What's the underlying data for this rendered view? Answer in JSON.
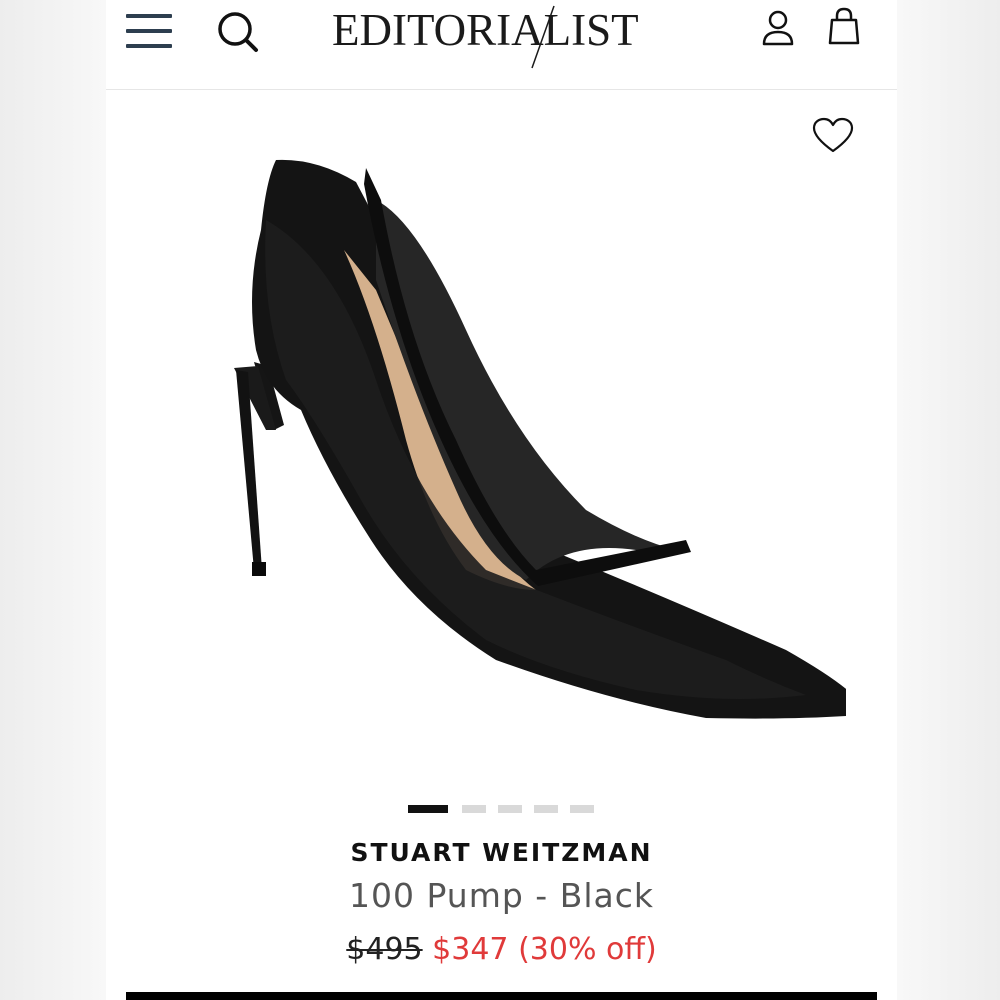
{
  "header": {
    "logo_text": "EDITORIALIST",
    "icons": {
      "menu": "hamburger-menu-icon",
      "search": "search-icon",
      "account": "user-icon",
      "bag": "shopping-bag-icon"
    }
  },
  "product": {
    "brand": "STUART WEITZMAN",
    "name": "100 Pump - Black",
    "price_original": "$495",
    "price_sale": "$347",
    "discount": "(30% off)",
    "wishlist_icon": "heart-icon",
    "gallery": {
      "image_count": 5,
      "active_index": 0
    }
  },
  "colors": {
    "nav_icon": "#2d3e4f",
    "sale_red": "#e03a3a",
    "text_dark": "#111111",
    "text_muted": "#555555"
  }
}
